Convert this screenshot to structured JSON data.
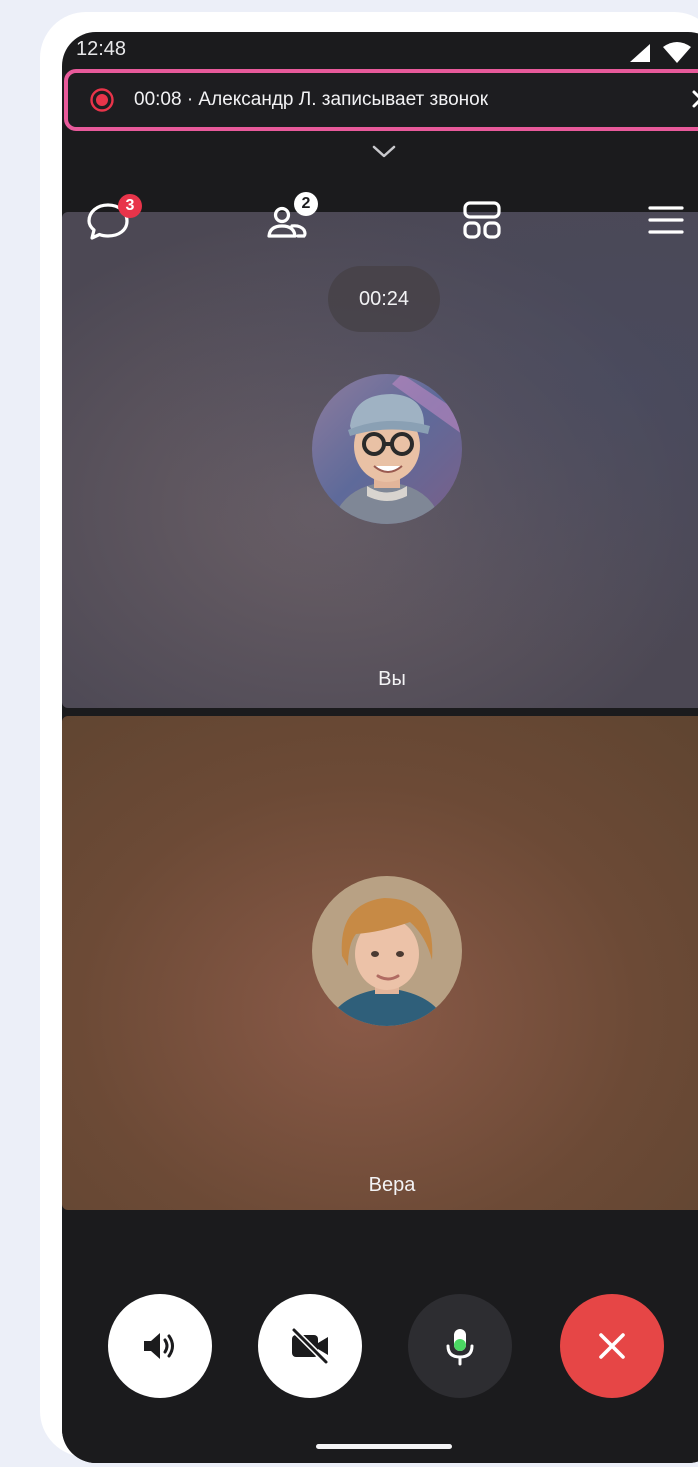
{
  "status_bar": {
    "time": "12:48"
  },
  "recording": {
    "text": "00:08 · Александр Л. записывает звонок"
  },
  "toolbar": {
    "chat_badge": "3",
    "participants_badge": "2"
  },
  "call": {
    "duration": "00:24"
  },
  "participants": [
    {
      "name": "Вы"
    },
    {
      "name": "Вера"
    }
  ],
  "colors": {
    "record_red": "#e8344a",
    "badge_red": "#e8344a",
    "end_call_red": "#e64646",
    "mic_green": "#4bd863",
    "highlight_pink": "#e85a9b"
  }
}
